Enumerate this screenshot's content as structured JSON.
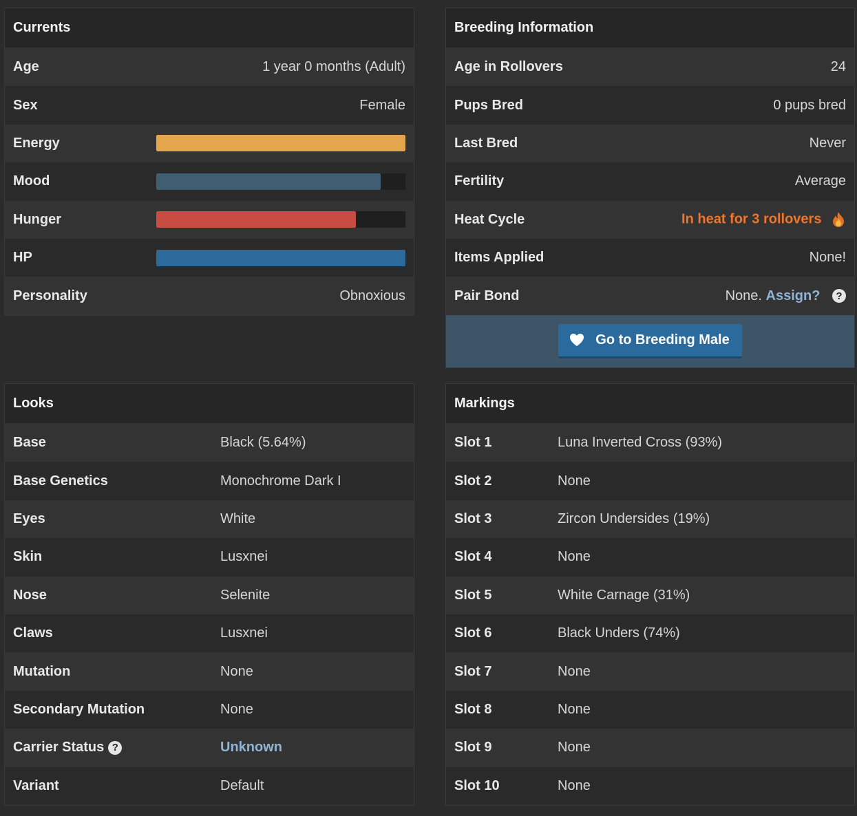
{
  "currents": {
    "title": "Currents",
    "age_label": "Age",
    "age_value": "1 year 0 months (Adult)",
    "sex_label": "Sex",
    "sex_value": "Female",
    "energy_label": "Energy",
    "energy_fraction": 1.0,
    "energy_color": "#e3a64c",
    "mood_label": "Mood",
    "mood_fraction": 0.9,
    "mood_color": "#3f5e71",
    "hunger_label": "Hunger",
    "hunger_fraction": 0.8,
    "hunger_color": "#c94c43",
    "hp_label": "HP",
    "hp_fraction": 1.0,
    "hp_color": "#2c6a9c",
    "personality_label": "Personality",
    "personality_value": "Obnoxious"
  },
  "breeding": {
    "title": "Breeding Information",
    "age_rollovers_label": "Age in Rollovers",
    "age_rollovers_value": "24",
    "pups_bred_label": "Pups Bred",
    "pups_bred_value": "0 pups bred",
    "last_bred_label": "Last Bred",
    "last_bred_value": "Never",
    "fertility_label": "Fertility",
    "fertility_value": "Average",
    "heat_cycle_label": "Heat Cycle",
    "heat_cycle_value": "In heat for 3 rollovers",
    "items_applied_label": "Items Applied",
    "items_applied_value": "None!",
    "pair_bond_label": "Pair Bond",
    "pair_bond_value": "None.",
    "pair_bond_link": "Assign?",
    "help_glyph": "?",
    "button_label": "Go to Breeding Male",
    "button_icon": "heart-icon"
  },
  "looks": {
    "title": "Looks",
    "rows": [
      {
        "label": "Base",
        "value": "Black (5.64%)"
      },
      {
        "label": "Base Genetics",
        "value": "Monochrome Dark I"
      },
      {
        "label": "Eyes",
        "value": "White"
      },
      {
        "label": "Skin",
        "value": "Lusxnei"
      },
      {
        "label": "Nose",
        "value": "Selenite"
      },
      {
        "label": "Claws",
        "value": "Lusxnei"
      },
      {
        "label": "Mutation",
        "value": "None"
      },
      {
        "label": "Secondary Mutation",
        "value": "None"
      },
      {
        "label": "Carrier Status",
        "value": "Unknown"
      },
      {
        "label": "Variant",
        "value": "Default"
      }
    ]
  },
  "markings": {
    "title": "Markings",
    "rows": [
      {
        "label": "Slot 1",
        "value": "Luna Inverted Cross (93%)"
      },
      {
        "label": "Slot 2",
        "value": "None"
      },
      {
        "label": "Slot 3",
        "value": "Zircon Undersides (19%)"
      },
      {
        "label": "Slot 4",
        "value": "None"
      },
      {
        "label": "Slot 5",
        "value": "White Carnage (31%)"
      },
      {
        "label": "Slot 6",
        "value": "Black Unders (74%)"
      },
      {
        "label": "Slot 7",
        "value": "None"
      },
      {
        "label": "Slot 8",
        "value": "None"
      },
      {
        "label": "Slot 9",
        "value": "None"
      },
      {
        "label": "Slot 10",
        "value": "None"
      }
    ]
  }
}
